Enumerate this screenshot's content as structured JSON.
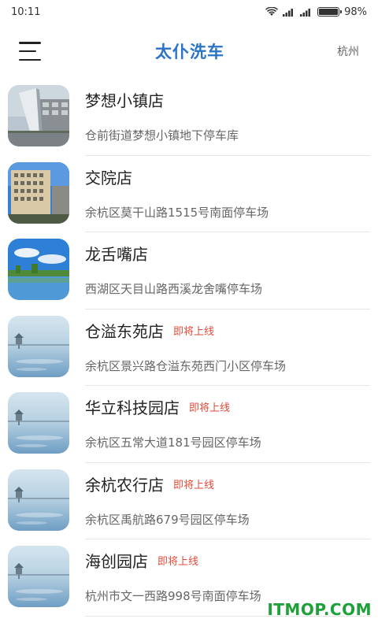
{
  "status_bar": {
    "time": "10:11",
    "battery_percent": "98%",
    "battery_level": 0.98
  },
  "header": {
    "title": "太仆洗车",
    "city": "杭州"
  },
  "stores": [
    {
      "name": "梦想小镇店",
      "badge": "",
      "address": "仓前街道梦想小镇地下停车库",
      "thumb": "building-sculpture"
    },
    {
      "name": "交院店",
      "badge": "",
      "address": "余杭区莫干山路1515号南面停车场",
      "thumb": "office-building"
    },
    {
      "name": "龙舌嘴店",
      "badge": "",
      "address": "西湖区天目山路西溪龙舍嘴停车场",
      "thumb": "lake-sky"
    },
    {
      "name": "仓溢东苑店",
      "badge": "即将上线",
      "address": "余杭区景兴路仓溢东苑西门小区停车场",
      "thumb": "misty-lake"
    },
    {
      "name": "华立科技园店",
      "badge": "即将上线",
      "address": "余杭区五常大道181号园区停车场",
      "thumb": "misty-lake"
    },
    {
      "name": "余杭农行店",
      "badge": "即将上线",
      "address": "余杭区禹航路679号园区停车场",
      "thumb": "misty-lake"
    },
    {
      "name": "海创园店",
      "badge": "即将上线",
      "address": "杭州市文一西路998号南面停车场",
      "thumb": "misty-lake"
    }
  ],
  "watermark": "ITMOP.COM"
}
